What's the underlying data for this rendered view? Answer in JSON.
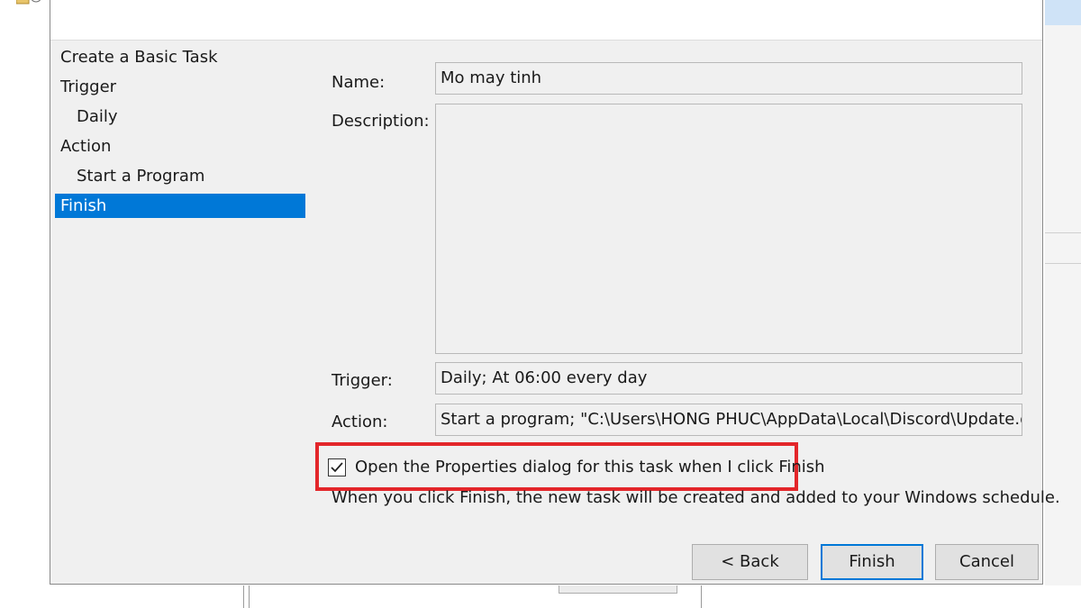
{
  "nav": {
    "items": [
      {
        "label": "Create a Basic Task",
        "level": 0,
        "active": false
      },
      {
        "label": "Trigger",
        "level": 0,
        "active": false
      },
      {
        "label": "Daily",
        "level": 1,
        "active": false
      },
      {
        "label": "Action",
        "level": 0,
        "active": false
      },
      {
        "label": "Start a Program",
        "level": 1,
        "active": false
      },
      {
        "label": "Finish",
        "level": 0,
        "active": true
      }
    ]
  },
  "form": {
    "name_label": "Name:",
    "name_value": "Mo may tinh",
    "description_label": "Description:",
    "description_value": "",
    "trigger_label": "Trigger:",
    "trigger_value": "Daily; At 06:00 every day",
    "action_label": "Action:",
    "action_value": "Start a program; \"C:\\Users\\HONG PHUC\\AppData\\Local\\Discord\\Update.exe\""
  },
  "options": {
    "open_properties_label": "Open the Properties dialog for this task when I click Finish",
    "open_properties_checked": true,
    "info_text": "When you click Finish, the new task will be created and added to your Windows schedule."
  },
  "buttons": {
    "back_label": "< Back",
    "finish_label": "Finish",
    "cancel_label": "Cancel"
  },
  "colors": {
    "accent": "#0078d7",
    "highlight_box": "#e3262a",
    "dialog_bg": "#f0f0f0"
  },
  "icons": {
    "background_app": "task-scheduler-icon",
    "checkbox": "checkmark-icon"
  }
}
